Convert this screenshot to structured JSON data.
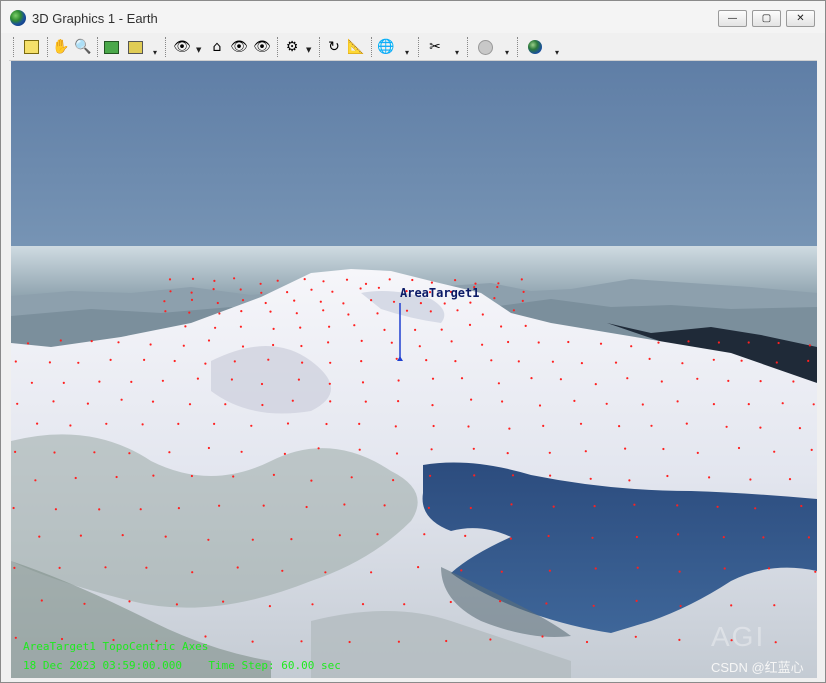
{
  "window": {
    "title": "3D Graphics 1 - Earth",
    "controls": {
      "minimize": "—",
      "maximize": "▢",
      "close": "✕"
    }
  },
  "toolbar": {
    "icons": [
      "properties-icon",
      "pan-hand-icon",
      "zoom-icon",
      "map-icon",
      "snapshot-icon",
      "eye-view-icon",
      "home-view-icon",
      "eye-from-icon",
      "eye-to-icon",
      "view-objects-icon",
      "rotate-icon",
      "measure-icon",
      "globe-icon",
      "tools-icon",
      "record-icon",
      "earth-icon"
    ]
  },
  "viewport": {
    "target_label": "AreaTarget1",
    "overlay_line1": "AreaTarget1 TopoCentric Axes",
    "overlay_line2": "18 Dec 2023 03:59:00.000    Time Step: 60.00 sec",
    "logo": "AGI",
    "watermark": "CSDN @红蓝心"
  },
  "colors": {
    "overlay_text": "#1eea1e",
    "sky_top": "#6b88ad",
    "sky_horizon": "#c9d7df",
    "snow": "#eef0f6",
    "water": "#2e4f80",
    "grid_points": "#ff2020"
  }
}
